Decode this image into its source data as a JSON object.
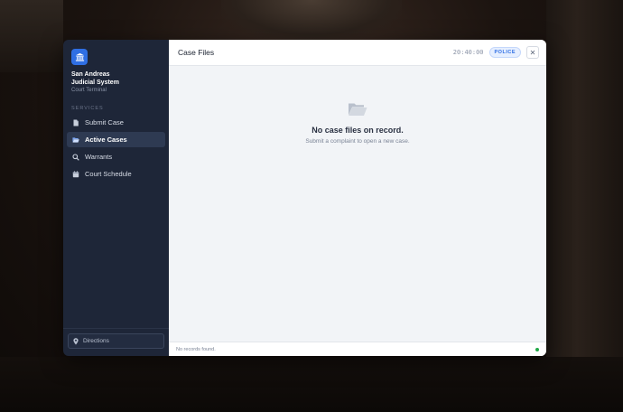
{
  "sidebar": {
    "brand": {
      "name": "San Andreas Judicial System",
      "subtitle": "Court Terminal",
      "logo_icon": "courthouse-icon",
      "logo_color": "#2f6fe4"
    },
    "section_label": "SERVICES",
    "items": [
      {
        "label": "Submit Case",
        "icon": "file-icon",
        "active": false
      },
      {
        "label": "Active Cases",
        "icon": "folder-open-icon",
        "active": true
      },
      {
        "label": "Warrants",
        "icon": "search-icon",
        "active": false
      },
      {
        "label": "Court Schedule",
        "icon": "calendar-icon",
        "active": false
      }
    ],
    "directions_label": "Directions",
    "directions_icon": "map-pin-icon"
  },
  "header": {
    "title": "Case Files",
    "clock": "20:40:00",
    "role_badge": "POLICE",
    "close_label": "✕"
  },
  "main": {
    "empty_title": "No case files on record.",
    "empty_subtitle": "Submit a complaint to open a new case.",
    "empty_icon": "folder-open-icon"
  },
  "footer": {
    "status_text": "No records found.",
    "status_color": "#22a847"
  },
  "colors": {
    "accent": "#2f6fe4",
    "sidebar_bg": "#1e2638",
    "sidebar_active_bg": "#2e3a52"
  }
}
